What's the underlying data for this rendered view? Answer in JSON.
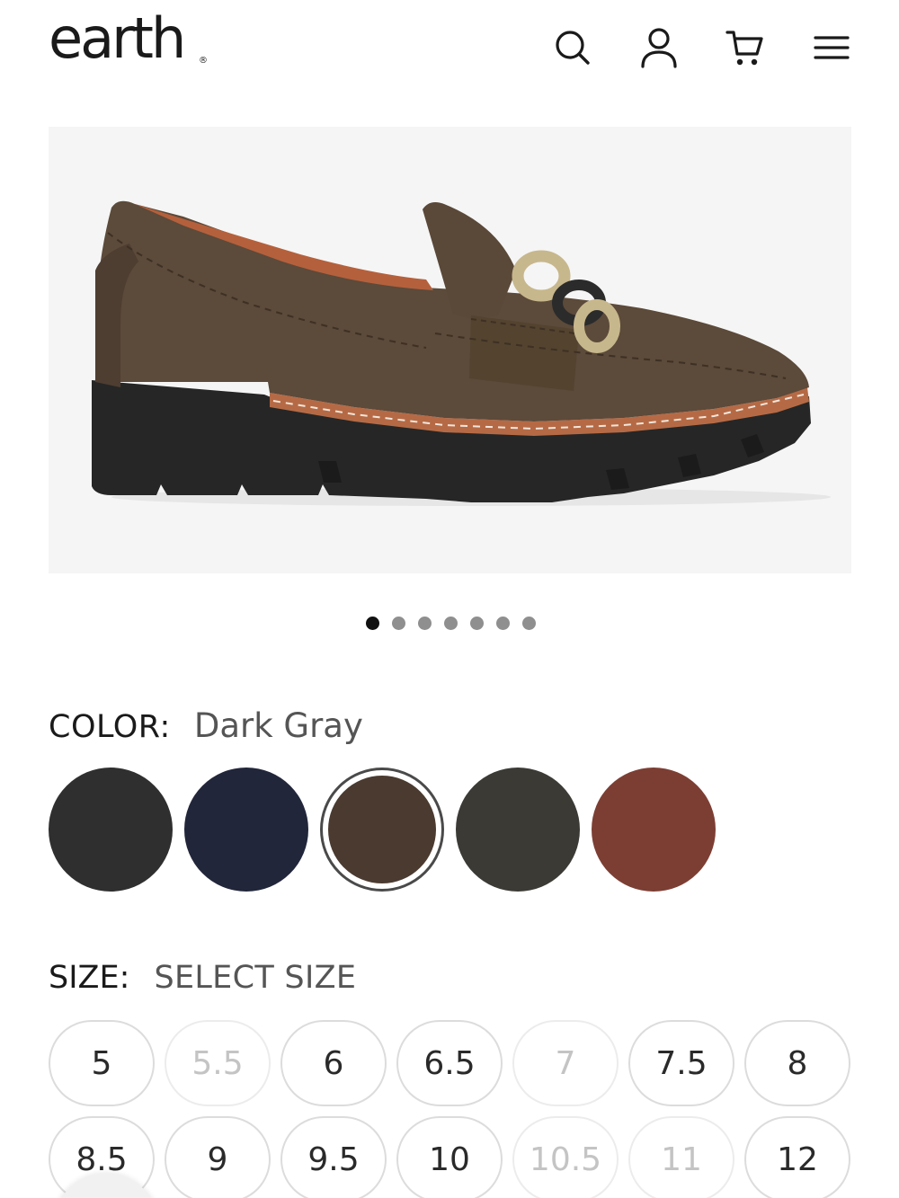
{
  "header": {
    "logo": "earth",
    "logo_mark": "®",
    "icons": [
      "search-icon",
      "account-icon",
      "cart-icon",
      "menu-icon"
    ]
  },
  "carousel": {
    "count": 7,
    "active_index": 0
  },
  "color": {
    "label": "COLOR:",
    "value": "Dark Gray",
    "swatches": [
      {
        "hex": "#2f2f2f",
        "selected": false
      },
      {
        "hex": "#22263a",
        "selected": false
      },
      {
        "hex": "#4a3a30",
        "selected": true
      },
      {
        "hex": "#3b3a35",
        "selected": false
      },
      {
        "hex": "#7c3e33",
        "selected": false
      }
    ]
  },
  "size": {
    "label": "SIZE:",
    "value": "SELECT SIZE",
    "options": [
      {
        "label": "5",
        "available": true
      },
      {
        "label": "5.5",
        "available": false
      },
      {
        "label": "6",
        "available": true
      },
      {
        "label": "6.5",
        "available": true
      },
      {
        "label": "7",
        "available": false
      },
      {
        "label": "7.5",
        "available": true
      },
      {
        "label": "8",
        "available": true
      },
      {
        "label": "8.5",
        "available": true
      },
      {
        "label": "9",
        "available": true
      },
      {
        "label": "9.5",
        "available": true
      },
      {
        "label": "10",
        "available": true
      },
      {
        "label": "10.5",
        "available": false
      },
      {
        "label": "11",
        "available": false
      },
      {
        "label": "12",
        "available": true
      }
    ]
  }
}
